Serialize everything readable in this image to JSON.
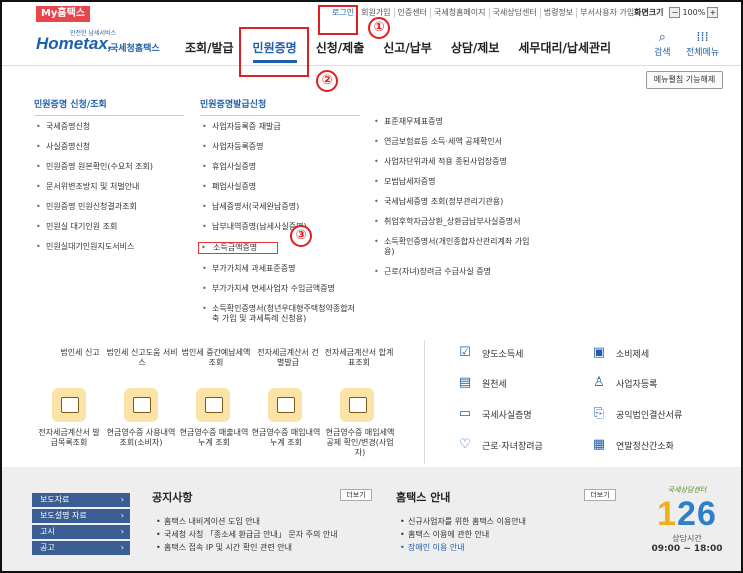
{
  "topbar": {
    "my_hometax": "My홈택스",
    "links": [
      "로그인",
      "회원가입",
      "인증센터",
      "국세청홈페이지",
      "국세상담센터",
      "법령정보",
      "부서사용자 가입하기"
    ],
    "screen_size_label": "화면크기",
    "zoom_minus": "−",
    "zoom_value": "100%",
    "zoom_plus": "+"
  },
  "header": {
    "logo_small": "안전한 납세서비스",
    "logo_text": "Hometax,",
    "logo_sub": "국세청홈택스",
    "nav": [
      "조회/발급",
      "민원증명",
      "신청/제출",
      "신고/납부",
      "상담/제보",
      "세무대리/납세관리"
    ],
    "search_label": "검색",
    "allmenu_label": "전체메뉴"
  },
  "mega": {
    "lock_button": "메뉴펼침 기능해제",
    "col1": {
      "title": "민원증명 신청/조회",
      "items": [
        "국세증명신청",
        "사실증명신청",
        "민원증명 원본확인(수요처 조회)",
        "문서위변조방지 및 처벌안내",
        "민원증명 민원신청결과조회",
        "민원실 대기인원 조회",
        "민원실대기인원지도서비스"
      ]
    },
    "col2": {
      "title": "민원증명발급신청",
      "items": [
        "사업자등록증 재발급",
        "사업자등록증명",
        "휴업사실증명",
        "폐업사실증명",
        "납세증명서(국세완납증명)",
        "납부내역증명(납세사실증명)",
        "소득금액증명",
        "부가가치세 과세표준증명",
        "부가가치세 면세사업자 수입금액증명",
        "소득확인증명서(청년우대형주택청약종합저축 가입 및 과세특례 신청용)"
      ]
    },
    "col3": {
      "items": [
        "표준재무제표증명",
        "연금보험료등 소득·세액 공제확인서",
        "사업자단위과세 적용 종된사업장증명",
        "모범납세자증명",
        "국세납세증명 조회(정부관리기관용)",
        "취업후학자금상환_상환금납부사실증명서",
        "소득확인증명서(개인종합자산관리계좌 가입용)",
        "근로(자녀)장려금 수급사실 증명"
      ]
    }
  },
  "annotations": [
    "①",
    "②",
    "③"
  ],
  "services": {
    "row_top": [
      "법인세 신고",
      "법인세 신고도움 서비스",
      "법인세 중간예납세액 조회",
      "전자세금계산서 건별발급",
      "전자세금계산서 합계표조회"
    ],
    "row_bottom": [
      "전자세금계산서 발급목록조회",
      "현금영수증 사용내역조회(소비자)",
      "현금영수증 매출내역누계 조회",
      "현금영수증 매입내역누계 조회",
      "현금영수증 매입세액공제 확인/변경(사업자)"
    ],
    "right": [
      "양도소득세",
      "소비제세",
      "원천세",
      "사업자등록",
      "국세사실증명",
      "공익법인결산서류",
      "근로·자녀장려금",
      "연말정산간소화"
    ]
  },
  "footer": {
    "side": [
      "보도자료",
      "보도설명 자료",
      "고시",
      "공고"
    ],
    "notice_title": "공지사항",
    "notice_more": "더보기",
    "notices": [
      "홈택스 내비게이션 도입 안내",
      "국세청 사칭 「종소세 환급금 안내」 문자 주의 안내",
      "홈택스 접속 IP 및 시간 확인 관련 안내"
    ],
    "guide_title": "홈택스 안내",
    "guide_more": "더보기",
    "guides": [
      "신규사업자를 위한 홈택스 이용안내",
      "홈택스 이용에 관한 안내",
      "장애인 이용 안내"
    ],
    "cc_name": "국세상담센터",
    "cc_number_a": "1",
    "cc_number_b": "26",
    "cc_label": "상담시간",
    "cc_time": "09:00 ~ 18:00"
  }
}
